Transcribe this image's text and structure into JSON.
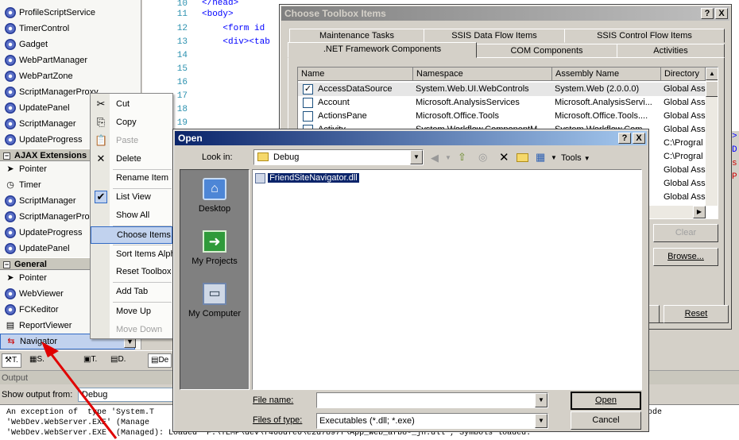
{
  "toolbox": {
    "items_top": [
      "ProfileScriptService",
      "TimerControl",
      "Gadget",
      "WebPartManager",
      "WebPartZone",
      "ScriptManagerProxy",
      "UpdatePanel",
      "ScriptManager",
      "UpdateProgress"
    ],
    "ajax_header": "AJAX Extensions",
    "ajax_items": [
      "Pointer",
      "Timer",
      "ScriptManager",
      "ScriptManagerProxy",
      "UpdateProgress",
      "UpdatePanel"
    ],
    "general_header": "General",
    "general_items": [
      "Pointer",
      "WebViewer",
      "FCKeditor",
      "ReportViewer",
      "Navigator"
    ],
    "bottom_tabs": [
      "T.",
      "S.",
      "T.",
      "D."
    ],
    "de_tab": "De"
  },
  "editor": {
    "line_numbers": [
      "10",
      "11",
      "12",
      "13",
      "14",
      "15",
      "16",
      "17",
      "18",
      "19"
    ],
    "lines": [
      "</head>",
      "<body>",
      "    <form id",
      "    <div><tab"
    ],
    "right_glyphs": [
      ">",
      "D",
      "s",
      "P"
    ]
  },
  "context_menu": {
    "items": [
      "Cut",
      "Copy",
      "Paste",
      "Delete",
      "Rename Item",
      "List View",
      "Show All",
      "Choose Items...",
      "Sort Items Alphabetically",
      "Reset Toolbox",
      "Add Tab",
      "Move Up",
      "Move Down"
    ]
  },
  "choose_dialog": {
    "title": "Choose Toolbox Items",
    "help_btn": "?",
    "close_btn": "X",
    "tabs_row1": [
      "Maintenance Tasks",
      "SSIS Data Flow Items",
      "SSIS Control Flow Items"
    ],
    "tabs_row2": [
      ".NET Framework Components",
      "COM Components",
      "Activities"
    ],
    "columns": [
      "Name",
      "Namespace",
      "Assembly Name",
      "Directory"
    ],
    "rows": [
      {
        "name": "AccessDataSource",
        "namespace": "System.Web.UI.WebControls",
        "assembly": "System.Web (2.0.0.0)",
        "dir": "Global Ass",
        "checked": true
      },
      {
        "name": "Account",
        "namespace": "Microsoft.AnalysisServices",
        "assembly": "Microsoft.AnalysisServi...",
        "dir": "Global Ass",
        "checked": false
      },
      {
        "name": "ActionsPane",
        "namespace": "Microsoft.Office.Tools",
        "assembly": "Microsoft.Office.Tools....",
        "dir": "Global Ass",
        "checked": false
      },
      {
        "name": "Activity",
        "namespace": "System.Workflow.ComponentM...",
        "assembly": "System.Workflow.Com...",
        "dir": "Global Ass",
        "checked": false
      }
    ],
    "dir_extra": [
      "C:\\Progral",
      "C:\\Progral",
      "Global Ass",
      "Global Ass",
      "Global Ass"
    ],
    "clear_btn": "Clear",
    "browse_btn": "Browse...",
    "reset_btn": "Reset"
  },
  "open_dialog": {
    "title": "Open",
    "help_btn": "?",
    "close_btn": "X",
    "look_in_label": "Look in:",
    "look_in_value": "Debug",
    "tools_label": "Tools",
    "places": [
      "Desktop",
      "My Projects",
      "My Computer"
    ],
    "files": [
      "FriendSiteNavigator.dll"
    ],
    "file_name_label": "File name:",
    "file_name_value": "",
    "file_type_label": "Files of type:",
    "file_type_value": "Executables (*.dll; *.exe)",
    "open_btn": "Open",
    "cancel_btn": "Cancel"
  },
  "output": {
    "title": "Output",
    "show_label": "Show output from:",
    "show_value": "Debug",
    "lines": [
      "An exception of  type 'System.T",
      "'WebDev.WebServer.EXE' (Manage",
      "'WebDev.WebServer.EXE' (Managed): Loaded 'F:\\TEMP\\dev\\f468dfe6\\e2d7897f\\App_Web_afb8-_jn.dll', Symbols loaded."
    ],
    "right_text": "ode"
  },
  "colors": {
    "titlebar_active": "#0a246a",
    "selection": "#c1d2ee",
    "arrow": "#e00000"
  }
}
